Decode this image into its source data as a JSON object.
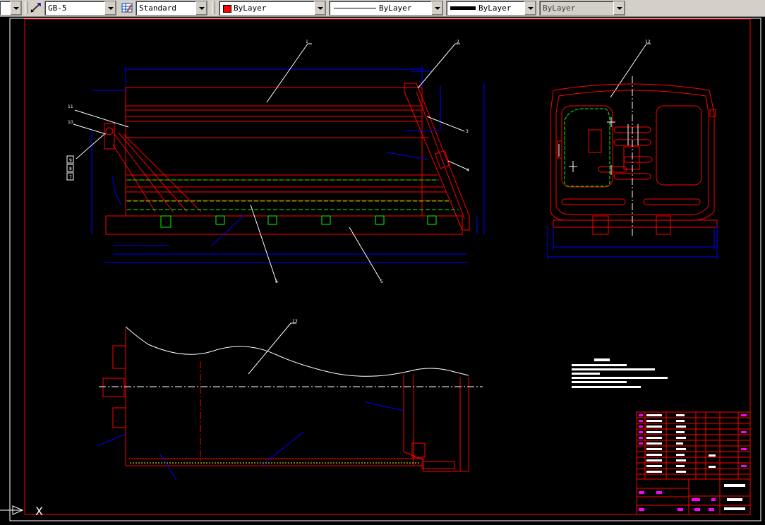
{
  "toolbar": {
    "dimstyle_value": "GB-5",
    "tablestyle_value": "Standard",
    "color_value": "ByLayer",
    "color_hex": "#ff0000",
    "linetype_value": "ByLayer",
    "lineweight_value": "ByLayer",
    "plotstyle_value": "ByLayer"
  },
  "drawing": {
    "balloons_side": [
      "1",
      "2",
      "3",
      "4",
      "5",
      "6",
      "7",
      "8",
      "9",
      "10",
      "11"
    ],
    "balloon_rear": "12",
    "balloon_top": "13",
    "colors": {
      "outline": "#ff0000",
      "dimension": "#0000ff",
      "hidden": "#00ff00",
      "text": "#ffffff",
      "highlight": "#ff00ff"
    }
  },
  "ucs": {
    "x_axis_label": "X"
  }
}
